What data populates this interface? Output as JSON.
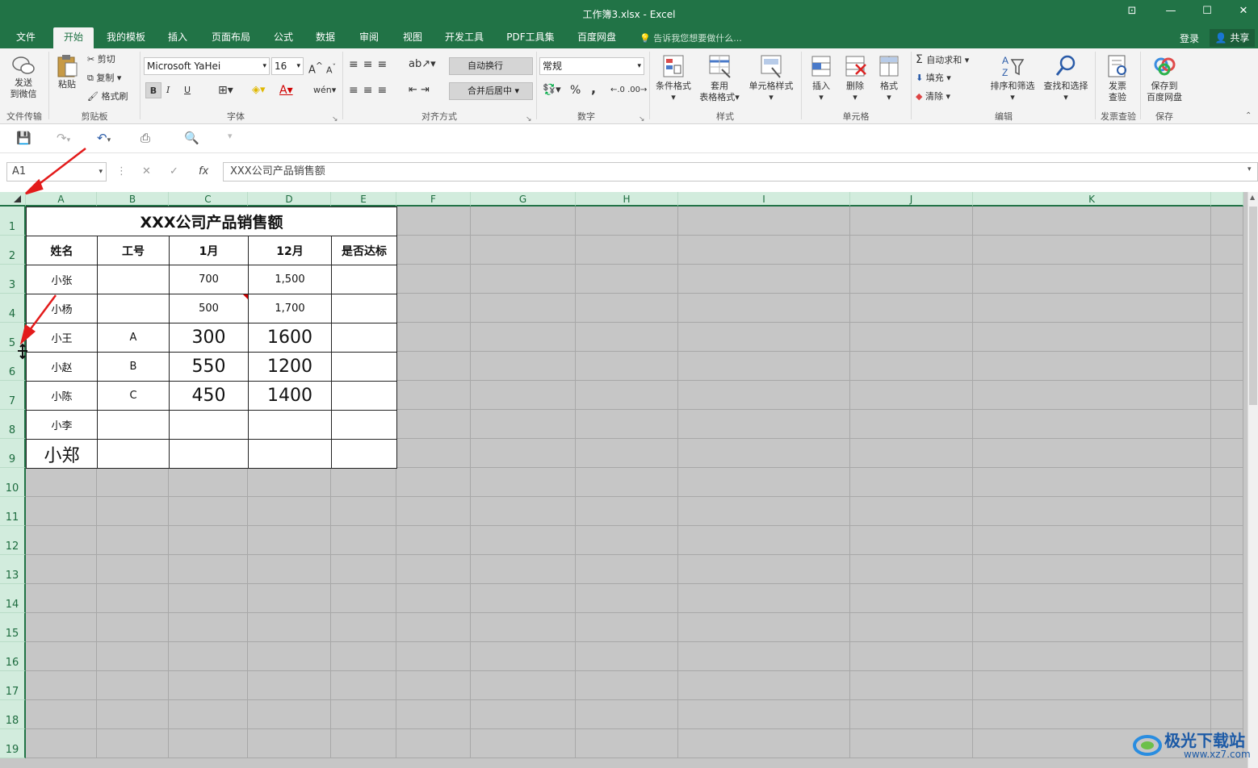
{
  "window": {
    "title": "工作簿3.xlsx - Excel"
  },
  "tabs": [
    {
      "label": "文件",
      "active": false
    },
    {
      "label": "开始",
      "active": true
    },
    {
      "label": "我的模板",
      "active": false
    },
    {
      "label": "插入",
      "active": false
    },
    {
      "label": "页面布局",
      "active": false
    },
    {
      "label": "公式",
      "active": false
    },
    {
      "label": "数据",
      "active": false
    },
    {
      "label": "审阅",
      "active": false
    },
    {
      "label": "视图",
      "active": false
    },
    {
      "label": "开发工具",
      "active": false
    },
    {
      "label": "PDF工具集",
      "active": false
    },
    {
      "label": "百度网盘",
      "active": false
    }
  ],
  "tellme": "告诉我您想要做什么...",
  "account": {
    "login": "登录",
    "share": "共享"
  },
  "ribbon": {
    "wechat": {
      "line1": "发送",
      "line2": "到微信",
      "group": "文件传输"
    },
    "clipboard": {
      "paste": "粘贴",
      "cut": "剪切",
      "copy": "复制",
      "painter": "格式刷",
      "group": "剪贴板"
    },
    "font": {
      "name": "Microsoft YaHei",
      "size": "16",
      "bold": "B",
      "italic": "I",
      "underline": "U",
      "grow": "A",
      "shrink": "A",
      "group": "字体"
    },
    "alignment": {
      "wrap": "自动换行",
      "merge": "合并后居中",
      "group": "对齐方式"
    },
    "number": {
      "format": "常规",
      "percent": "%",
      "comma": ",",
      "group": "数字"
    },
    "styles": {
      "conditional": "条件格式",
      "table_line1": "套用",
      "table_line2": "表格格式",
      "cell_styles": "单元格样式",
      "group": "样式"
    },
    "cells": {
      "insert": "插入",
      "delete": "删除",
      "format": "格式",
      "group": "单元格"
    },
    "editing": {
      "autosum": "自动求和",
      "fill": "填充",
      "clear": "清除",
      "sort": "排序和筛选",
      "find": "查找和选择",
      "group": "编辑"
    },
    "invoice": {
      "line1": "发票",
      "line2": "查验",
      "group": "发票查验"
    },
    "save": {
      "line1": "保存到",
      "line2": "百度网盘",
      "group": "保存"
    }
  },
  "formula_bar": {
    "name_box": "A1",
    "fx": "fx",
    "content": "XXX公司产品销售额"
  },
  "columns": [
    "A",
    "B",
    "C",
    "D",
    "E",
    "F",
    "G",
    "H",
    "I",
    "J",
    "K"
  ],
  "rows": [
    "1",
    "2",
    "3",
    "4",
    "5",
    "6",
    "7",
    "8",
    "9",
    "10",
    "11",
    "12",
    "13",
    "14",
    "15",
    "16",
    "17",
    "18",
    "19"
  ],
  "sheet": {
    "title": "XXX公司产品销售额",
    "headers": [
      "姓名",
      "工号",
      "1月",
      "12月",
      "是否达标"
    ],
    "data": [
      [
        "小张",
        "",
        "700",
        "1,500",
        ""
      ],
      [
        "小杨",
        "",
        "500",
        "1,700",
        ""
      ],
      [
        "小王",
        "A",
        "300",
        "1600",
        ""
      ],
      [
        "小赵",
        "B",
        "550",
        "1200",
        ""
      ],
      [
        "小陈",
        "C",
        "450",
        "1400",
        ""
      ],
      [
        "小李",
        "",
        "",
        "",
        ""
      ],
      [
        "小郑",
        "",
        "",
        "",
        ""
      ]
    ],
    "row_styles": [
      "sm",
      "sm",
      "lg",
      "lg",
      "lg",
      "sm",
      "lg"
    ]
  },
  "watermark": {
    "name": "极光下载站",
    "url": "www.xz7.com"
  }
}
